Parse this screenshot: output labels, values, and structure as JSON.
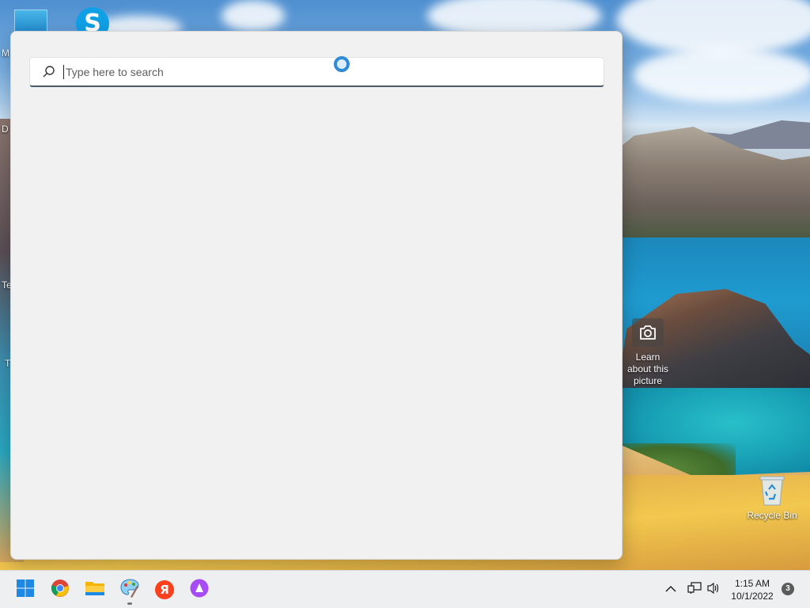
{
  "desktop": {
    "learn_picture_label": "Learn about this picture",
    "learn_picture_icon": "camera-icon",
    "recycle_bin_label": "Recycle Bin",
    "recycle_bin_icon": "recycle-bin-icon",
    "skype_letter": "S",
    "edge_letters": [
      "M",
      "D",
      "Te",
      "T"
    ]
  },
  "search": {
    "placeholder": "Type here to search",
    "value": "",
    "icon": "search-icon",
    "accent": "#2f8ad8"
  },
  "taskbar": {
    "apps": [
      {
        "name": "start",
        "icon": "windows-logo-icon"
      },
      {
        "name": "chrome",
        "icon": "chrome-icon"
      },
      {
        "name": "file-explorer",
        "icon": "folder-icon"
      },
      {
        "name": "paint",
        "icon": "paint-palette-icon"
      },
      {
        "name": "yandex-browser",
        "icon": "yandex-icon",
        "letter": "Я"
      },
      {
        "name": "alice",
        "icon": "alice-assistant-icon"
      }
    ],
    "tray": {
      "chevron_icon": "chevron-up-icon",
      "network_icon": "network-icon",
      "volume_icon": "volume-icon"
    },
    "time": "1:15 AM",
    "date": "10/1/2022",
    "notification_count": "3"
  }
}
